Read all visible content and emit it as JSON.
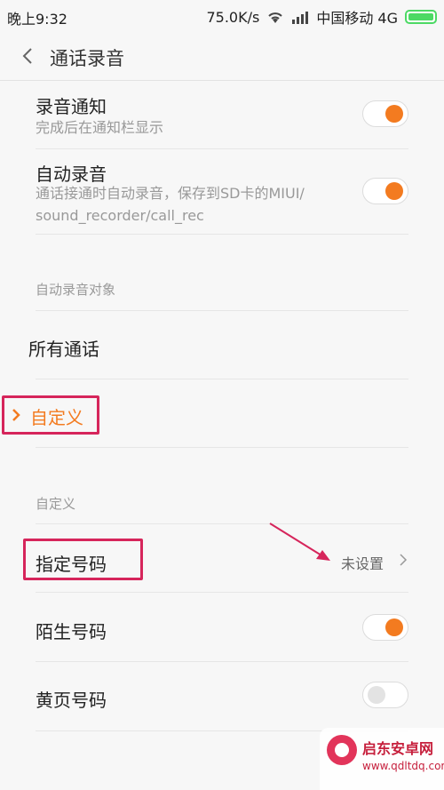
{
  "status_bar": {
    "time": "晚上9:32",
    "speed": "75.0K/s",
    "carrier": "中国移动 4G"
  },
  "header": {
    "title": "通话录音"
  },
  "settings": {
    "notify": {
      "title": "录音通知",
      "subtitle": "完成后在通知栏显示",
      "enabled": true
    },
    "auto_record": {
      "title": "自动录音",
      "subtitle_line1": "通话接通时自动录音，保存到SD卡的MIUI/",
      "subtitle_line2": "sound_recorder/call_rec",
      "enabled": true
    }
  },
  "auto_target_section": {
    "label": "自动录音对象",
    "options": [
      {
        "label": "所有通话",
        "selected": false
      },
      {
        "label": "自定义",
        "selected": true
      }
    ]
  },
  "custom_section": {
    "label": "自定义",
    "specified_numbers": {
      "title": "指定号码",
      "value": "未设置"
    },
    "stranger_numbers": {
      "title": "陌生号码",
      "enabled": true
    },
    "yellow_page_numbers": {
      "title": "黄页号码",
      "enabled": false
    }
  },
  "watermark": {
    "title": "启东安卓网",
    "url": "www.qdltdq.com"
  },
  "colors": {
    "accent": "#f37b20",
    "highlight": "#d6255b",
    "battery": "#4cd964"
  }
}
